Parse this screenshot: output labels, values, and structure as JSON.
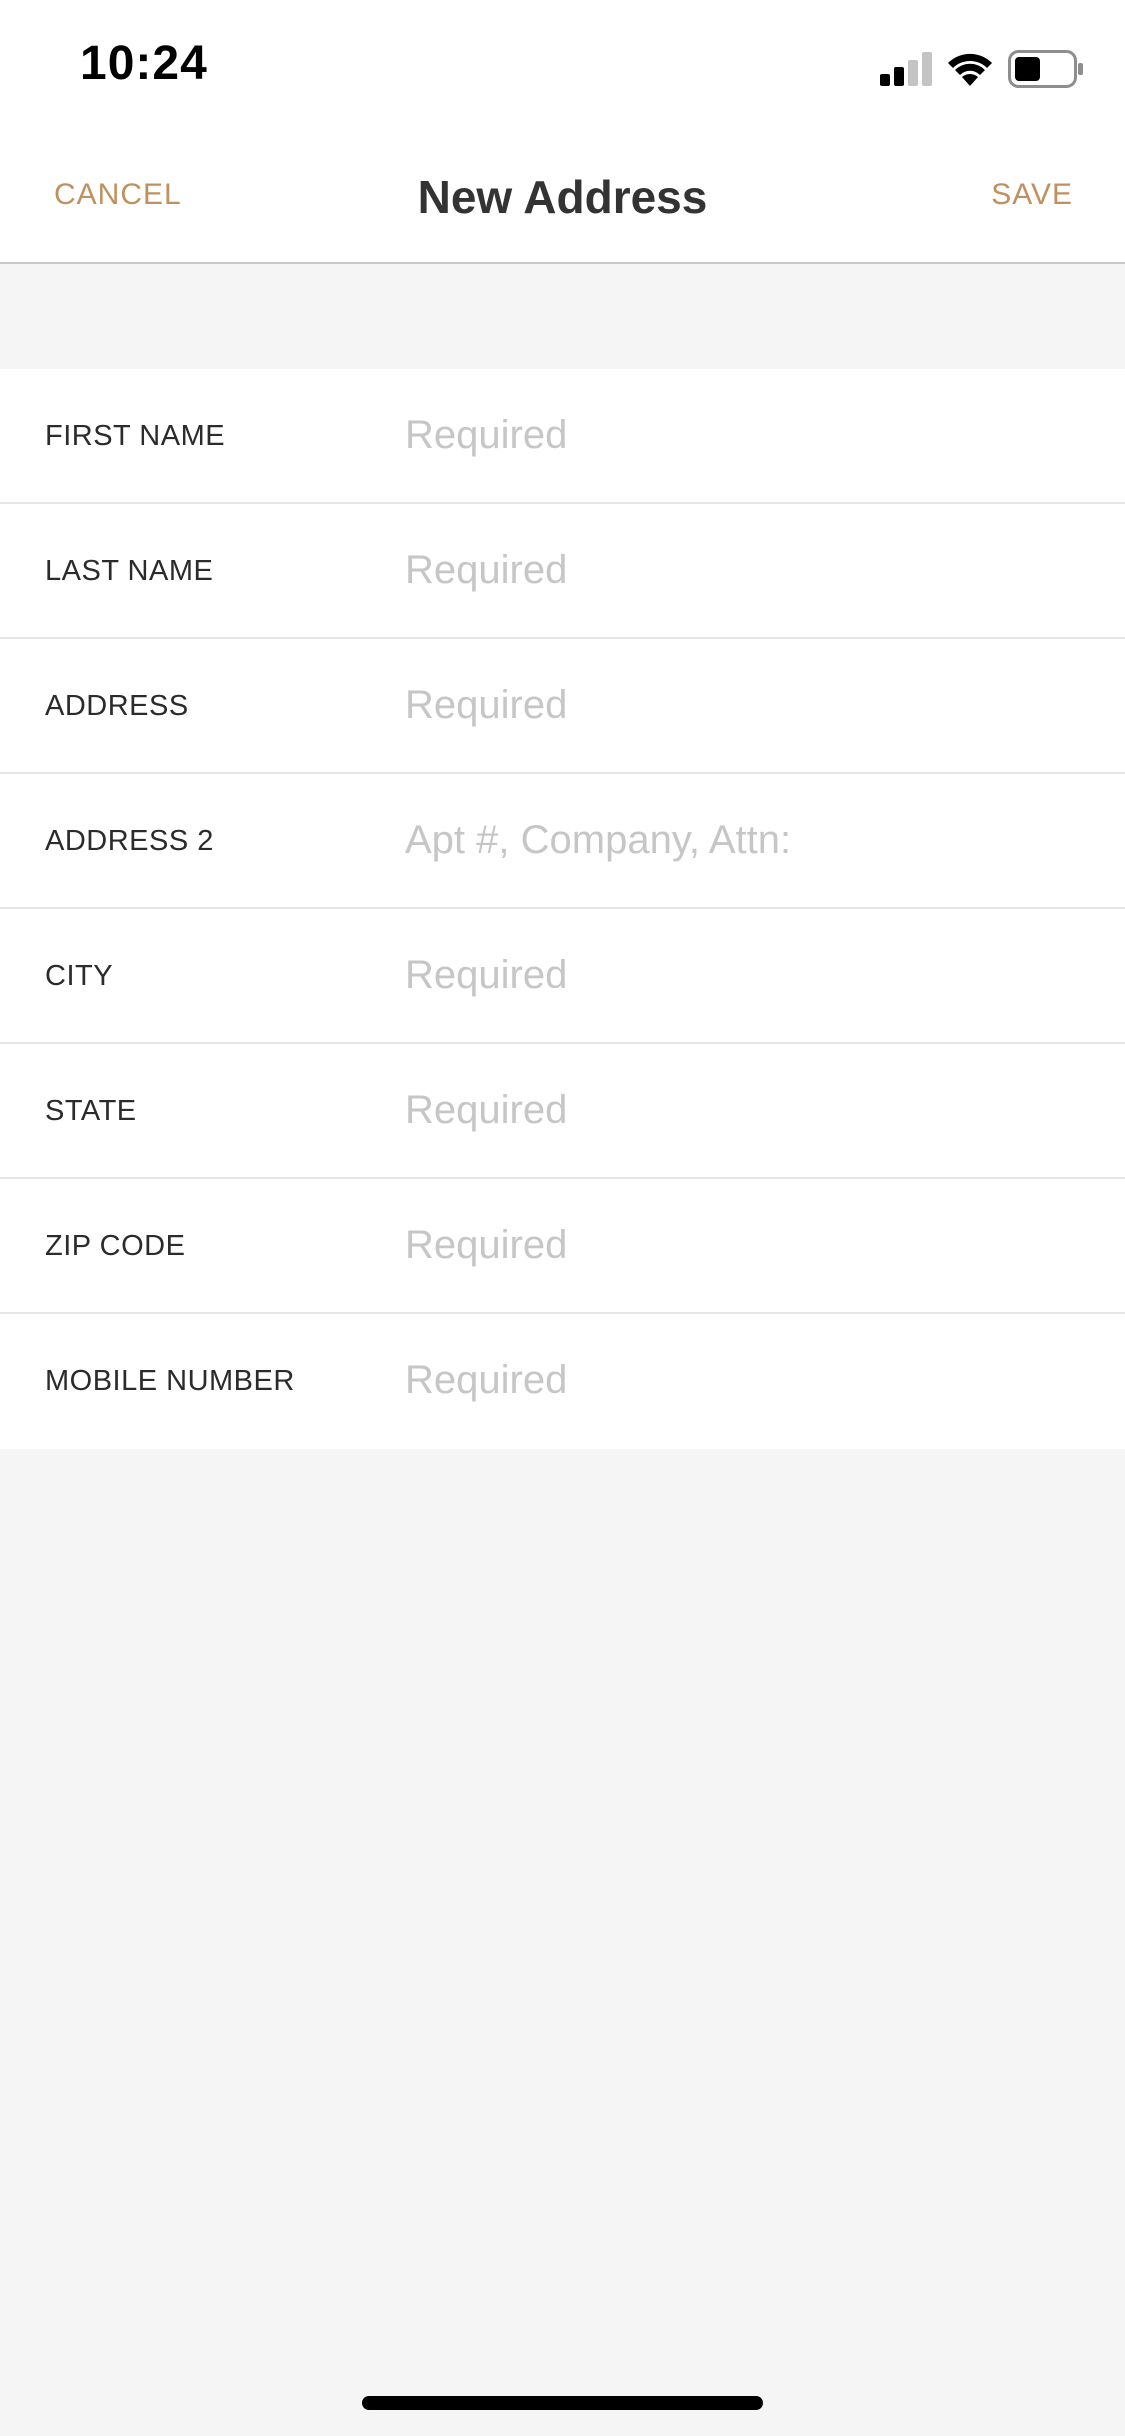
{
  "status_bar": {
    "time": "10:24",
    "icons": [
      "signal-icon",
      "wifi-icon",
      "battery-icon"
    ]
  },
  "nav": {
    "cancel_label": "CANCEL",
    "title": "New Address",
    "save_label": "SAVE"
  },
  "colors": {
    "accent": "#c0905e",
    "background": "#f5f5f5",
    "placeholder": "#c6c6c6"
  },
  "form": {
    "fields": [
      {
        "label": "FIRST NAME",
        "value": "",
        "placeholder": "Required"
      },
      {
        "label": "LAST NAME",
        "value": "",
        "placeholder": "Required"
      },
      {
        "label": "ADDRESS",
        "value": "",
        "placeholder": "Required"
      },
      {
        "label": "ADDRESS 2",
        "value": "",
        "placeholder": "Apt #, Company, Attn:"
      },
      {
        "label": "CITY",
        "value": "",
        "placeholder": "Required"
      },
      {
        "label": "STATE",
        "value": "",
        "placeholder": "Required"
      },
      {
        "label": "ZIP CODE",
        "value": "",
        "placeholder": "Required"
      },
      {
        "label": "MOBILE NUMBER",
        "value": "",
        "placeholder": "Required"
      }
    ]
  }
}
